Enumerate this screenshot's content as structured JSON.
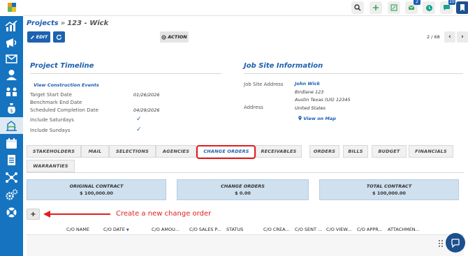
{
  "colors": {
    "sidebar": "#1573c0",
    "primary": "#1d62b0",
    "link": "#1d5fae",
    "highlight": "#e31d1d",
    "summary_bg": "#cfe0ef"
  },
  "sidebar": {
    "icons": [
      "app-logo-icon",
      "dashboard-chart-icon",
      "marketing-megaphone-icon",
      "mail-icon",
      "contacts-person-icon",
      "projects-people-icon",
      "money-bag-icon",
      "job-site-icon",
      "calendar-icon",
      "documents-icon",
      "network-icon",
      "settings-gears-icon",
      "support-lifebuoy-icon"
    ]
  },
  "topbar": {
    "buttons": [
      "search-icon",
      "plus-icon",
      "edit-note-icon",
      "mail-icon",
      "clock-icon",
      "chat-icon",
      "bookmark-icon"
    ],
    "badges": {
      "mail": "2",
      "chat": "10"
    }
  },
  "breadcrumb": {
    "link": "Projects",
    "separator": "»",
    "current": "123 - Wick"
  },
  "toolbar": {
    "edit_label": "EDIT",
    "action_label": "ACTION",
    "pager_text": "2 / 68",
    "prev": "‹",
    "next": "›"
  },
  "timeline": {
    "title": "Project Timeline",
    "link": "View Construction Events",
    "rows": [
      {
        "label": "Target Start Date",
        "value": "01/26/2026"
      },
      {
        "label": "Benchmark End Date",
        "value": ""
      },
      {
        "label": "Scheduled Completion Date",
        "value": "04/29/2026"
      },
      {
        "label": "Include Saturdays",
        "value": "✓"
      },
      {
        "label": "Include Sundays",
        "value": "✓"
      }
    ]
  },
  "job_site": {
    "title": "Job Site Information",
    "address_label": "Job Site Address",
    "name": "John Wick",
    "street": "Birdlane 123",
    "city": "Austin  Texas (US)  12345",
    "address2_label": "Address",
    "country": "United States",
    "map_link": "View on Map"
  },
  "tabs": {
    "row1": [
      "STAKEHOLDERS",
      "MAIL",
      "SELECTIONS",
      "AGENCIES",
      "CHANGE ORDERS",
      "RECEIVABLES",
      "ORDERS",
      "BILLS",
      "BUDGET",
      "FINANCIALS"
    ],
    "row2": [
      "WARRANTIES"
    ],
    "active": "CHANGE ORDERS"
  },
  "summary": [
    {
      "title": "ORIGINAL CONTRACT",
      "value": "$ 100,000.00"
    },
    {
      "title": "CHANGE ORDERS",
      "value": "$ 0.00"
    },
    {
      "title": "TOTAL CONTRACT",
      "value": "$ 100,000.00"
    }
  ],
  "add_button": "+",
  "annotation": "Create a new change order",
  "table": {
    "headers": [
      "C/O NAME",
      "C/O DATE",
      "C/O AMOU...",
      "C/O SALES P...",
      "STATUS",
      "C/O CREA...",
      "C/O SENT ...",
      "C/O VIEW...",
      "C/O APPR...",
      "ATTACHMEN..."
    ],
    "sort_indicator": "▼"
  }
}
